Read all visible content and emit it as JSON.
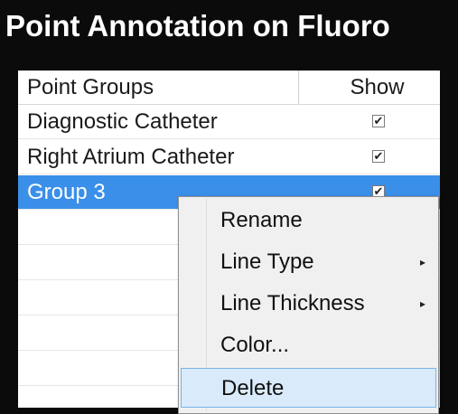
{
  "title": "Point Annotation on Fluoro",
  "table": {
    "headers": {
      "group": "Point Groups",
      "show": "Show"
    },
    "rows": [
      {
        "name": "Diagnostic Catheter",
        "show": true
      },
      {
        "name": "Right Atrium Catheter",
        "show": true
      },
      {
        "name": "Group 3",
        "show": true,
        "selected": true
      }
    ]
  },
  "context_menu": {
    "items": [
      {
        "label": "Rename",
        "submenu": false
      },
      {
        "label": "Line Type",
        "submenu": true
      },
      {
        "label": "Line Thickness",
        "submenu": true
      },
      {
        "label": "Color...",
        "submenu": false
      },
      {
        "label": "Delete",
        "submenu": false,
        "highlighted": true
      }
    ],
    "submenu_arrow": "▸"
  },
  "checkmark": "✔",
  "colors": {
    "selection": "#3a8fe8",
    "menu_hover": "#d9ebfb",
    "background": "#0b0b0b"
  }
}
